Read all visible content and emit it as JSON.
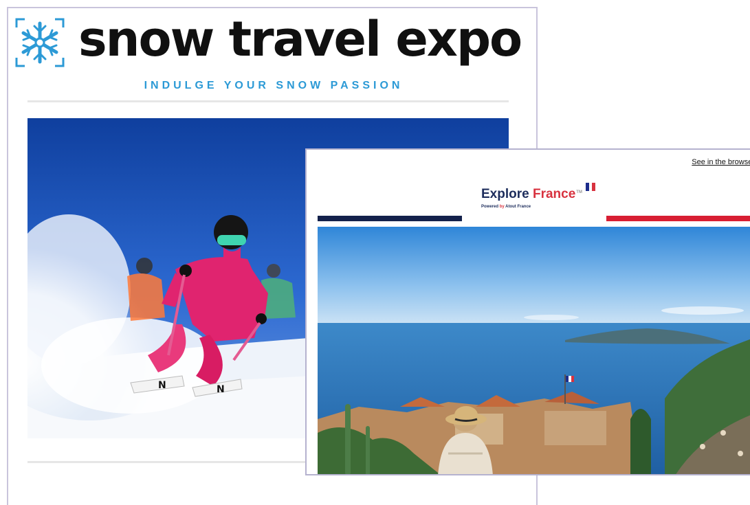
{
  "snow_email": {
    "brand": "snow travel expo",
    "tagline": "INDULGE YOUR SNOW PASSION",
    "hero_alt": "Skier in pink outfit carving through powder snow"
  },
  "france_email": {
    "browser_link": "See in the browser",
    "brand_part1": "Explore ",
    "brand_part2": "France",
    "trademark": "TM",
    "powered_prefix": "Powered ",
    "powered_by": "by ",
    "powered_name": "Atout France",
    "hero_alt": "Woman in straw hat overlooking Mediterranean coastline and hilltop village"
  },
  "colors": {
    "snow_accent": "#2c9ad6",
    "france_navy": "#14214b",
    "france_red": "#d81e33"
  }
}
